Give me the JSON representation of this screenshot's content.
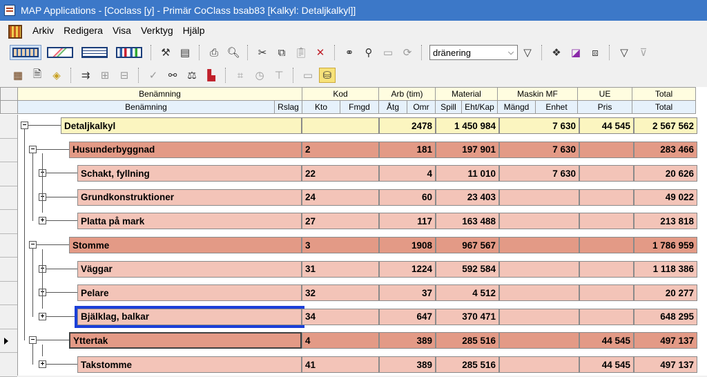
{
  "window": {
    "title": "MAP Applications - [Coclass [y] - Primär CoClass bsab83 [Kalkyl: Detaljkalkyl]]"
  },
  "menu": [
    "Arkiv",
    "Redigera",
    "Visa",
    "Verktyg",
    "Hjälp"
  ],
  "toolbar": {
    "filter_value": "dränering"
  },
  "header": {
    "groups": [
      "Benämning",
      "Kod",
      "Arb (tim)",
      "Material",
      "Maskin MF",
      "UE",
      "Total"
    ],
    "columns": [
      "Benämning",
      "Rslag",
      "Kto",
      "Fmgd",
      "Åtg",
      "Omr",
      "Spill",
      "Eht/Kap",
      "Mängd",
      "Enhet",
      "Pris",
      "Total"
    ]
  },
  "rows": [
    {
      "name": "Detaljkalkyl",
      "kto": "",
      "atg": "2478",
      "material": "1 450 984",
      "maskin": "7 630",
      "ue": "44 545",
      "total": "2 567 562",
      "level": 0,
      "color": "#fbf5c0"
    },
    {
      "name": "Husunderbyggnad",
      "kto": "2",
      "atg": "181",
      "material": "197 901",
      "maskin": "7 630",
      "ue": "",
      "total": "283 466",
      "level": 1,
      "color": "#e39a86"
    },
    {
      "name": "Schakt, fyllning",
      "kto": "22",
      "atg": "4",
      "material": "11 010",
      "maskin": "7 630",
      "ue": "",
      "total": "20 626",
      "level": 2,
      "color": "#f3c4b8"
    },
    {
      "name": "Grundkonstruktioner",
      "kto": "24",
      "atg": "60",
      "material": "23 403",
      "maskin": "",
      "ue": "",
      "total": "49 022",
      "level": 2,
      "color": "#f3c4b8"
    },
    {
      "name": "Platta på mark",
      "kto": "27",
      "atg": "117",
      "material": "163 488",
      "maskin": "",
      "ue": "",
      "total": "213 818",
      "level": 2,
      "color": "#f3c4b8"
    },
    {
      "name": "Stomme",
      "kto": "3",
      "atg": "1908",
      "material": "967 567",
      "maskin": "",
      "ue": "",
      "total": "1 786 959",
      "level": 1,
      "color": "#e39a86"
    },
    {
      "name": "Väggar",
      "kto": "31",
      "atg": "1224",
      "material": "592 584",
      "maskin": "",
      "ue": "",
      "total": "1 118 386",
      "level": 2,
      "color": "#f3c4b8"
    },
    {
      "name": "Pelare",
      "kto": "32",
      "atg": "37",
      "material": "4 512",
      "maskin": "",
      "ue": "",
      "total": "20 277",
      "level": 2,
      "color": "#f3c4b8"
    },
    {
      "name": "Bjälklag, balkar",
      "kto": "34",
      "atg": "647",
      "material": "370 471",
      "maskin": "",
      "ue": "",
      "total": "648 295",
      "level": 2,
      "color": "#f3c4b8"
    },
    {
      "name": "Yttertak",
      "kto": "4",
      "atg": "389",
      "material": "285 516",
      "maskin": "",
      "ue": "44 545",
      "total": "497 137",
      "level": 1,
      "color": "#e39a86"
    },
    {
      "name": "Takstomme",
      "kto": "41",
      "atg": "389",
      "material": "285 516",
      "maskin": "",
      "ue": "44 545",
      "total": "497 137",
      "level": 2,
      "color": "#f3c4b8"
    }
  ]
}
